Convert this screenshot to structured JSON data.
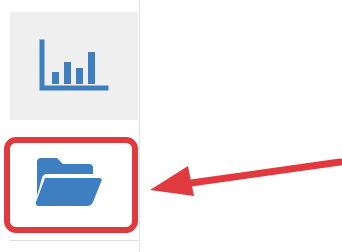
{
  "sidebar": {
    "items": [
      {
        "icon": "bar-chart-icon",
        "state": "default"
      },
      {
        "icon": "folder-open-icon",
        "state": "highlighted"
      }
    ]
  },
  "annotation": {
    "highlight_color": "#e0393e",
    "arrow_color": "#e0393e",
    "icon_color": "#3d7fc1"
  }
}
